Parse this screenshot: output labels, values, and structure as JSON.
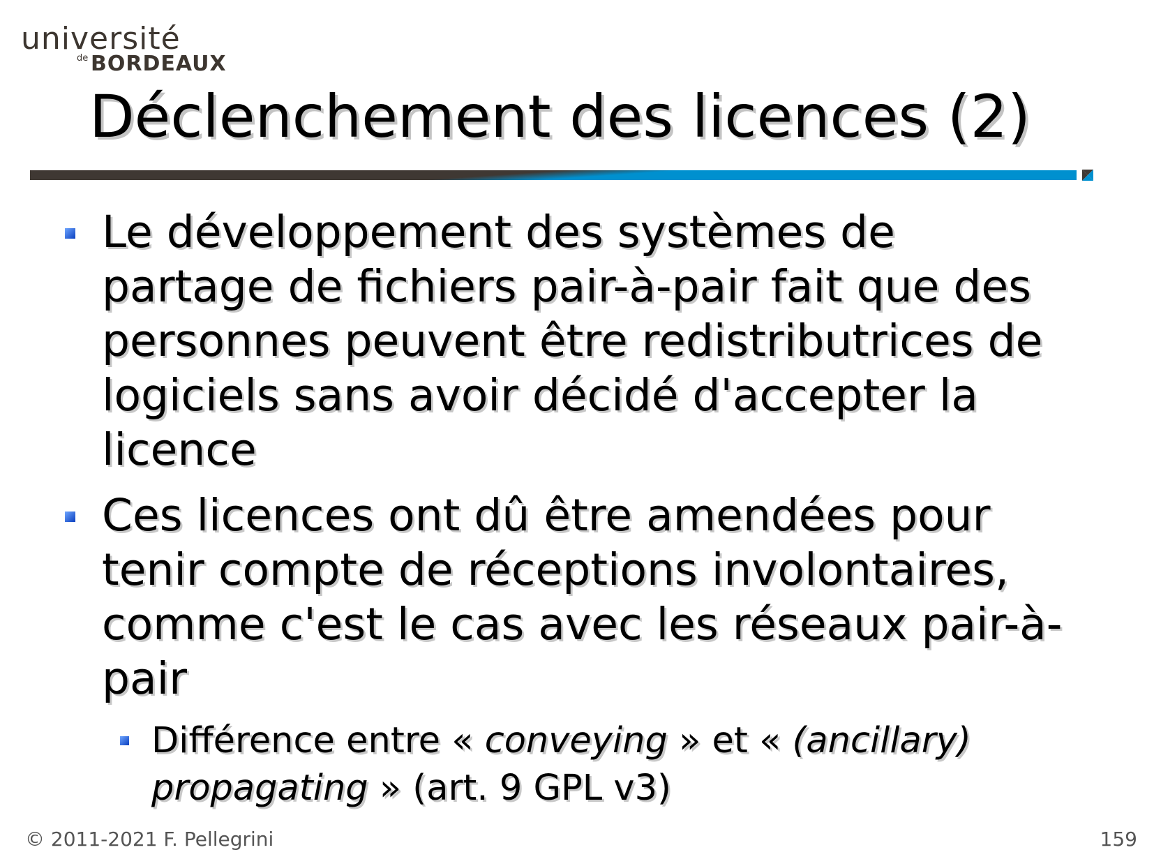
{
  "logo": {
    "line1": "université",
    "small": "de",
    "line2": "BORDEAUX"
  },
  "title": "Déclenchement des licences (2)",
  "colors": {
    "accent": "#0090cf",
    "dark": "#3f3833"
  },
  "bullets": [
    {
      "lines": [
        "Le développement des systèmes de",
        "partage de fichiers pair-à-pair fait que des",
        "personnes peuvent être redistributrices de",
        "logiciels sans avoir décidé d'accepter la",
        "licence"
      ]
    },
    {
      "lines": [
        "Ces licences ont dû être amendées pour",
        "tenir compte de réceptions involontaires,",
        "comme c'est le cas avec les réseaux pair-à-",
        "pair"
      ]
    }
  ],
  "sub_bullet": {
    "t1": "Différence entre « ",
    "i1": "conveying",
    "t2": " » et « ",
    "i2": "(ancillary)",
    "i3": "propagating",
    "t3": " » (art. 9 GPL v3)"
  },
  "footer": {
    "copyright": "© 2011-2021 F. Pellegrini",
    "page": "159"
  }
}
